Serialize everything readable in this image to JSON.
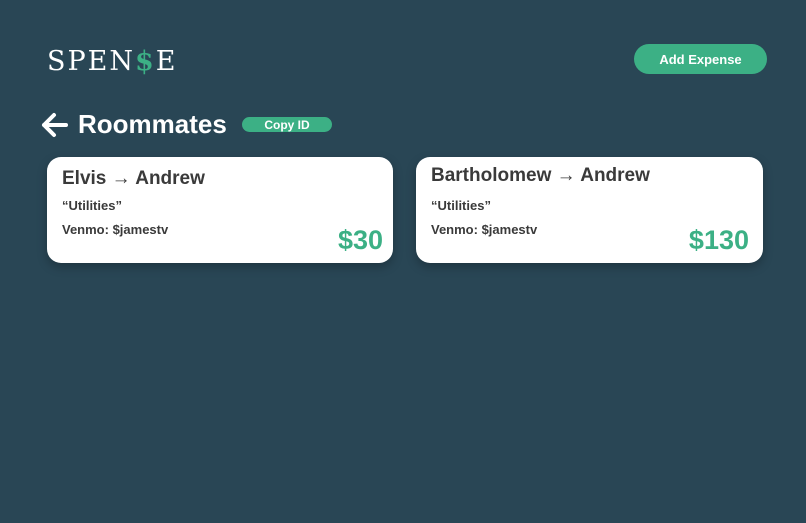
{
  "app": {
    "logo_prefix": "SPEN",
    "logo_dollar": "$",
    "logo_suffix": "E",
    "accent_color": "#3cb085",
    "background_color": "#294655"
  },
  "header": {
    "add_expense_label": "Add Expense"
  },
  "page": {
    "back_icon": "arrow-left-icon",
    "title": "Roommates",
    "copy_id_label": "Copy ID"
  },
  "debts": [
    {
      "from": "Elvis",
      "arrow": "→",
      "to": "Andrew",
      "note": "“Utilities”",
      "venmo": "Venmo: $jamestv",
      "amount": "$30"
    },
    {
      "from": "Bartholomew",
      "arrow": "→",
      "to": "Andrew",
      "note": "“Utilities”",
      "venmo": "Venmo: $jamestv",
      "amount": "$130"
    }
  ]
}
